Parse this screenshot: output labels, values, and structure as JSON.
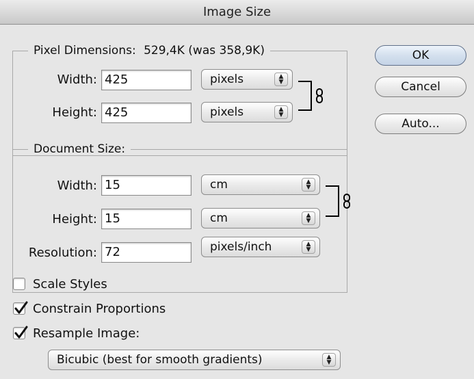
{
  "window": {
    "title": "Image Size"
  },
  "pixel_dimensions": {
    "legend_label": "Pixel Dimensions:",
    "legend_value": "529,4K (was 358,9K)",
    "width": {
      "label": "Width:",
      "value": "425",
      "unit": "pixels"
    },
    "height": {
      "label": "Height:",
      "value": "425",
      "unit": "pixels"
    }
  },
  "document_size": {
    "legend_label": "Document Size:",
    "width": {
      "label": "Width:",
      "value": "15",
      "unit": "cm"
    },
    "height": {
      "label": "Height:",
      "value": "15",
      "unit": "cm"
    },
    "resolution": {
      "label": "Resolution:",
      "value": "72",
      "unit": "pixels/inch"
    }
  },
  "buttons": {
    "ok": "OK",
    "cancel": "Cancel",
    "auto": "Auto..."
  },
  "options": {
    "scale_styles": {
      "label": "Scale Styles",
      "checked": false
    },
    "constrain_proportions": {
      "label": "Constrain Proportions",
      "checked": true
    },
    "resample_image": {
      "label": "Resample Image:",
      "checked": true
    }
  },
  "resample_method": {
    "selected": "Bicubic (best for smooth gradients)"
  },
  "icons": {
    "link": "chain-link-icon",
    "updown": "up-down-arrows-icon",
    "check": "checkmark-icon"
  }
}
